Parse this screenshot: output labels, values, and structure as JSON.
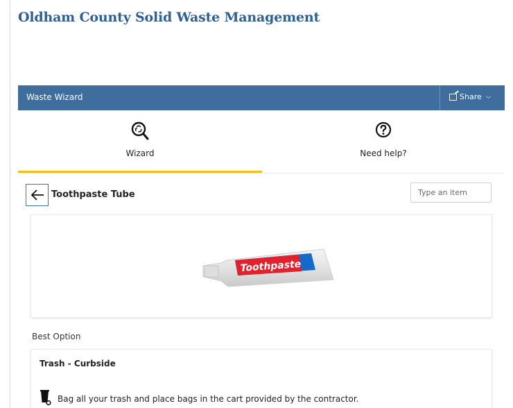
{
  "header": {
    "site_title": "Oldham County Solid Waste Management"
  },
  "banner": {
    "title": "Waste Wizard",
    "share_label": "Share"
  },
  "tabs": [
    {
      "label": "Wizard",
      "icon": "recycle-search-icon",
      "active": true
    },
    {
      "label": "Need help?",
      "icon": "question-circle-icon",
      "active": false
    }
  ],
  "item": {
    "title": "Toothpaste Tube",
    "image_text": "Toothpaste"
  },
  "search": {
    "placeholder": "Type an item"
  },
  "best_option": {
    "section_label": "Best Option",
    "title": "Trash - Curbside",
    "description": "Bag all your trash and place bags in the cart provided by the contractor."
  },
  "colors": {
    "brand_blue": "#3f6e9e",
    "title_blue": "#2f5f93",
    "accent_yellow": "#f2c21b"
  }
}
